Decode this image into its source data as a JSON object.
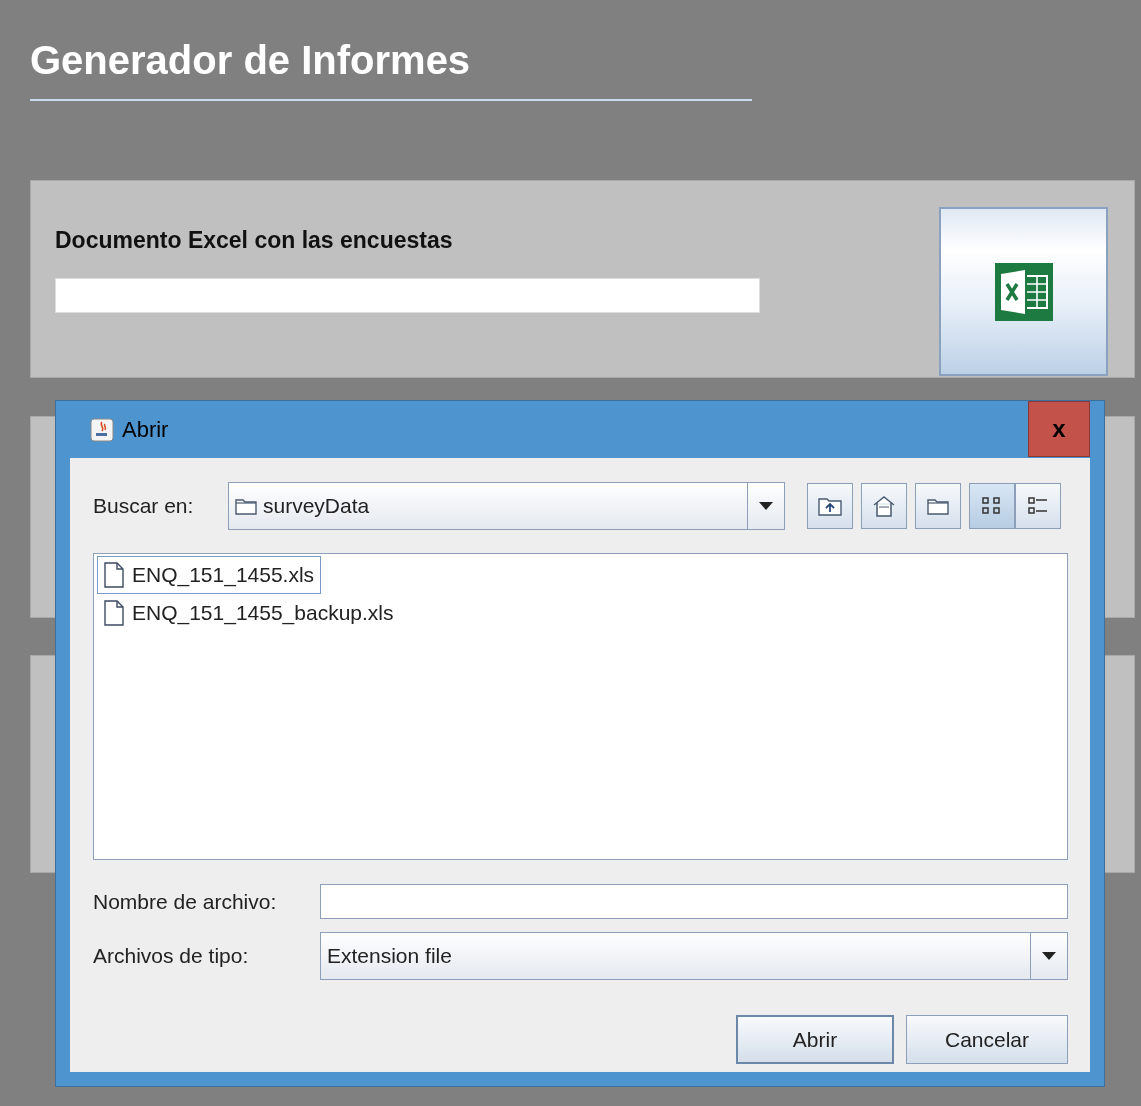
{
  "app": {
    "title": "Generador de Informes"
  },
  "excel_panel": {
    "label": "Documento Excel con las encuestas"
  },
  "dialog": {
    "title": "Abrir",
    "look_in": {
      "label": "Buscar en:",
      "value": "surveyData"
    },
    "files": [
      {
        "name": "ENQ_151_1455.xls",
        "selected": true
      },
      {
        "name": "ENQ_151_1455_backup.xls",
        "selected": false
      }
    ],
    "file_name": {
      "label": "Nombre de archivo:"
    },
    "file_type": {
      "label": "Archivos de tipo:",
      "value": "Extension file"
    },
    "buttons": [
      {
        "label": "Abrir",
        "kind": "default"
      },
      {
        "label": "Cancelar",
        "kind": "normal"
      }
    ],
    "close": "x"
  }
}
